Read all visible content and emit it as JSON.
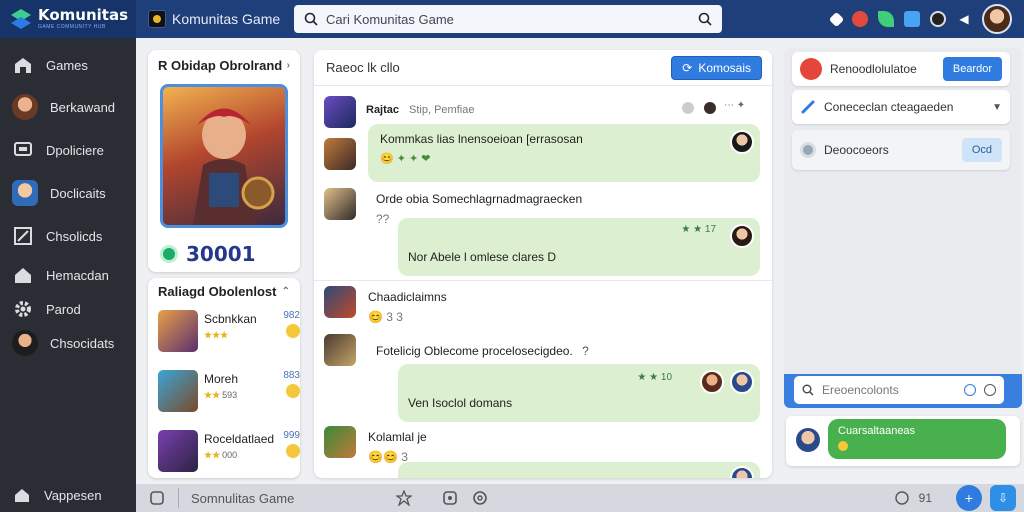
{
  "app": {
    "brand_title": "Komunitas",
    "brand_subtitle": "GAME COMMUNITY HUB",
    "game_label": "Komunitas Game",
    "search_placeholder": "Cari Komunitas Game"
  },
  "sidebar": {
    "items": [
      {
        "label": "Games",
        "icon": "gamepad-icon"
      },
      {
        "label": "Berkawand",
        "icon": "avatar"
      },
      {
        "label": "Dpoliciere",
        "icon": "chat-icon"
      },
      {
        "label": "Doclicaits",
        "icon": "avatar"
      },
      {
        "label": "Chsolicds",
        "icon": "edit-icon"
      },
      {
        "label": "Hemacdan",
        "icon": "home-icon"
      },
      {
        "label": "Parod",
        "icon": "gear-icon"
      },
      {
        "label": "Chsocidats",
        "icon": "avatar"
      }
    ],
    "footer_label": "Vappesen"
  },
  "left_card": {
    "title": "R Obidap Obrolrand",
    "score": "30001",
    "recommended_title": "Raliagd Obolenlost",
    "recommended": [
      {
        "name": "Scbnkkan",
        "stars": "★★★",
        "count": "",
        "num": "982"
      },
      {
        "name": "Moreh",
        "stars": "★★",
        "count": "593",
        "num": "883"
      },
      {
        "name": "Roceldatlaed",
        "stars": "★★",
        "count": "000",
        "num": "999"
      }
    ]
  },
  "chat": {
    "header_title": "Raeoc lk cllo",
    "header_button": "Komosais",
    "thread_user": "Rajtac",
    "thread_meta": "Stip, Pemfiae",
    "messages": [
      {
        "text": "Kommkas lias lnensoeioan [errasosan",
        "emojis": "😊 ✦ ✦ ❤"
      },
      {
        "text": "Orde obia Somechlagrnadmagraecken",
        "sub": "?? "
      },
      {
        "text": "Nor Abele l omlese clares D",
        "time": "★ ★ 17"
      },
      {
        "text": "Chaadiclaimns",
        "sub": "😊 3 3"
      },
      {
        "text": "Fotelicig Oblecome procelosecigdeo.",
        "sub": "?"
      },
      {
        "text": "Ven Isoclol domans",
        "time": "★ ★ 10"
      },
      {
        "text": "Kolamlal je",
        "sub": "😊😊 3"
      }
    ]
  },
  "right_panel": {
    "top_item": "Renoodlolulatoe",
    "top_button": "Beardor",
    "dropdown": "Conececlan cteagaeden",
    "field_label": "Deoocoeors",
    "field_button": "Ocd",
    "search_placeholder": "Ereoencolonts"
  },
  "right_bottom": {
    "message": "Cuarsaltaaneas"
  },
  "bottom_bar": {
    "placeholder": "Somnulitas Game",
    "count": "91"
  },
  "colors": {
    "topbar": "#1e3f7a",
    "sidebar": "#2a2d33",
    "accent": "#2f7be0",
    "bubble": "#dcefd0"
  }
}
